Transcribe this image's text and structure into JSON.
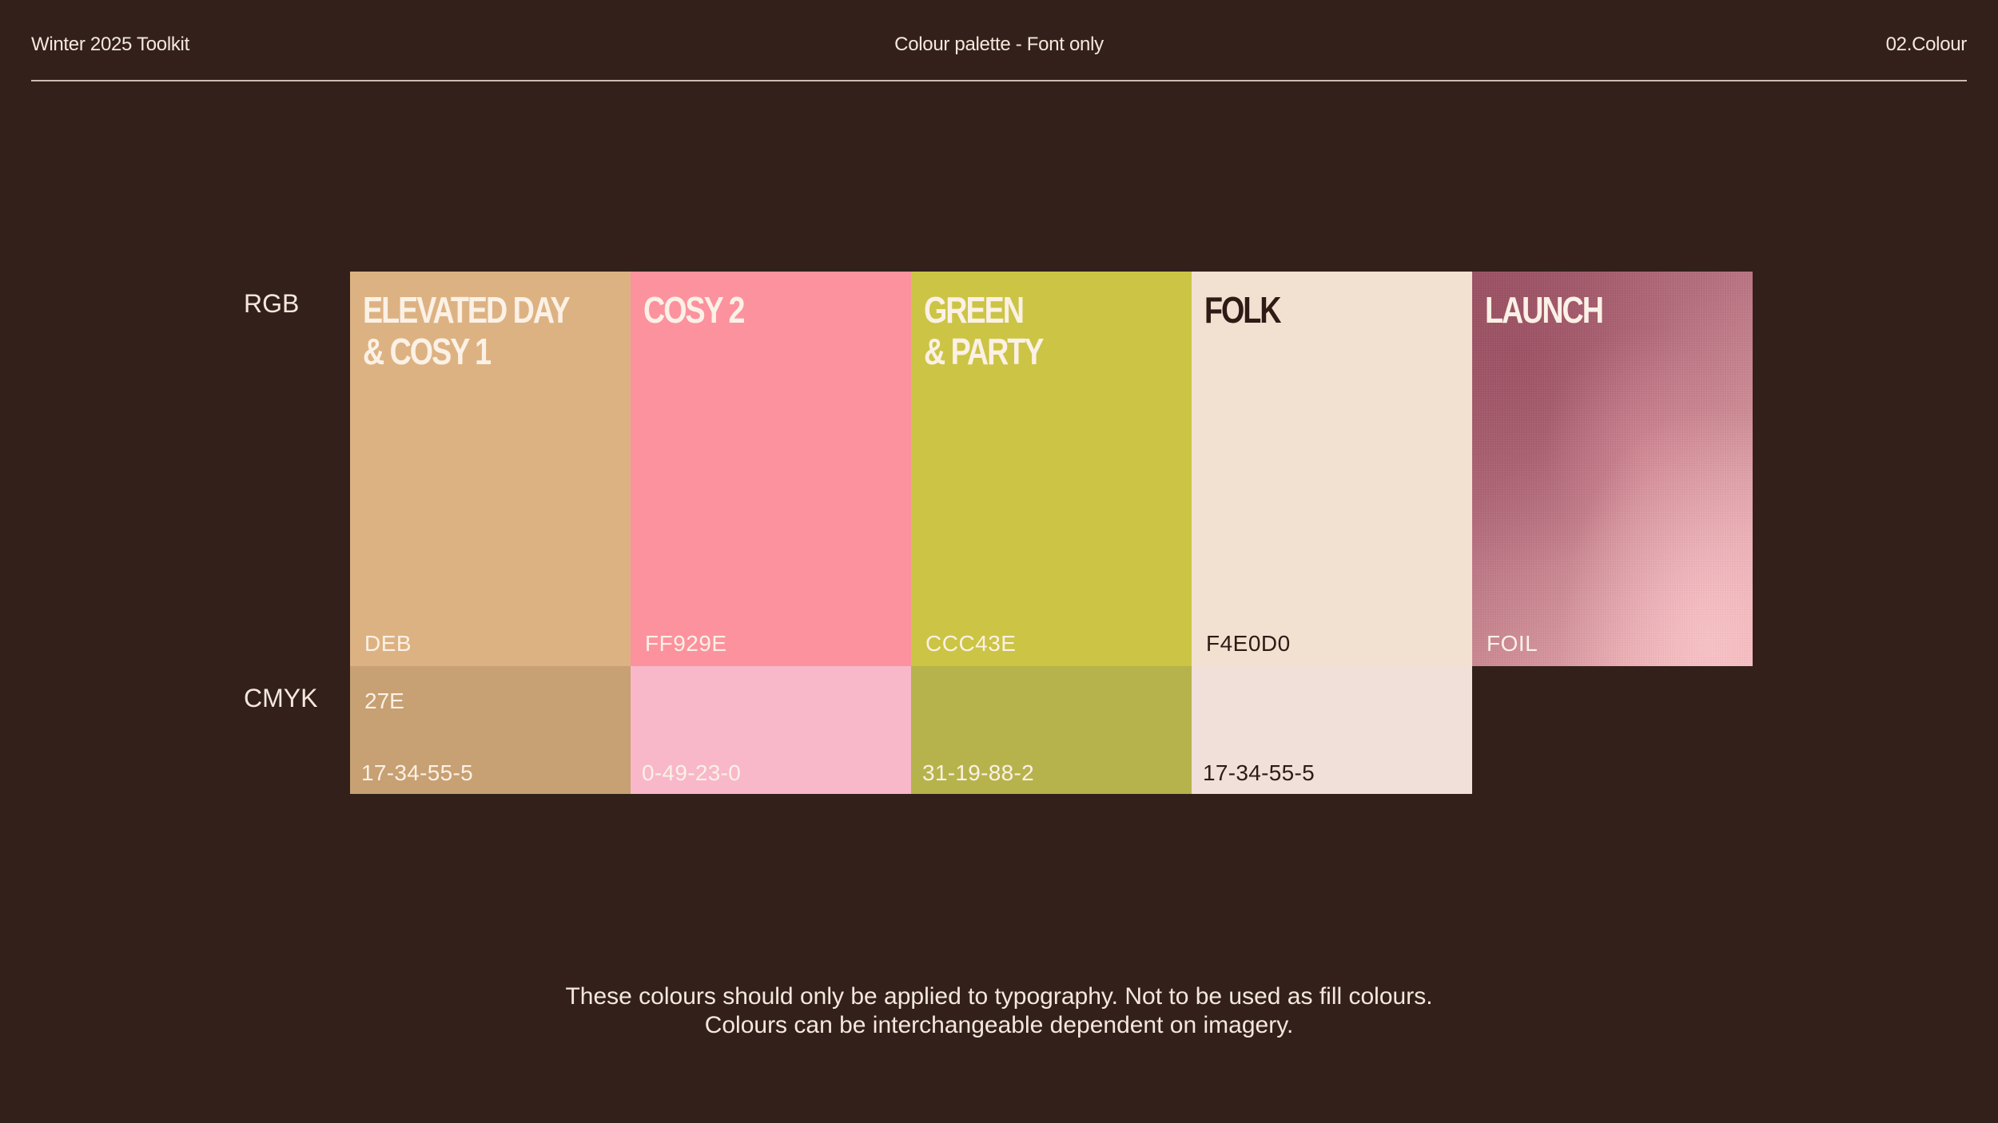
{
  "header": {
    "left": "Winter 2025 Toolkit",
    "center": "Colour palette - Font only",
    "right": "02.Colour"
  },
  "row_labels": {
    "rgb": "RGB",
    "cmyk": "CMYK"
  },
  "swatches": [
    {
      "title": "ELEVATED DAY\n& COSY 1",
      "rgb_code": "DEB",
      "cmyk_top": "27E",
      "cmyk_value": "17-34-55-5",
      "rgb_color": "#ddb282",
      "cmyk_color": "#c7a073",
      "title_color": "#fbf1e6",
      "code_color": "#fbf1e6"
    },
    {
      "title": "COSY 2",
      "rgb_code": "FF929E",
      "cmyk_top": "",
      "cmyk_value": "0-49-23-0",
      "rgb_color": "#fc929e",
      "cmyk_color": "#f8b8c9",
      "title_color": "#fbf1e6",
      "code_color": "#fbf1e6"
    },
    {
      "title": "GREEN\n& PARTY",
      "rgb_code": "CCC43E",
      "cmyk_top": "",
      "cmyk_value": "31-19-88-2",
      "rgb_color": "#ccc444",
      "cmyk_color": "#b6b34c",
      "title_color": "#fbf1e6",
      "code_color": "#fbf1e6"
    },
    {
      "title": "FOLK",
      "rgb_code": "F4E0D0",
      "cmyk_top": "",
      "cmyk_value": "17-34-55-5",
      "rgb_color": "#f2e1d1",
      "cmyk_color": "#f1dfd9",
      "title_color": "#2f1a15",
      "code_color": "#2f1a15"
    },
    {
      "title": "LAUNCH",
      "rgb_code": "FOIL",
      "rgb_color": "#b96e7d",
      "title_color": "#fbf1e6",
      "code_color": "#fbf1e6"
    }
  ],
  "footer": {
    "line1": "These colours should only be applied to typography. Not to be used as fill colours.",
    "line2": "Colours can be interchangeable dependent on imagery."
  }
}
